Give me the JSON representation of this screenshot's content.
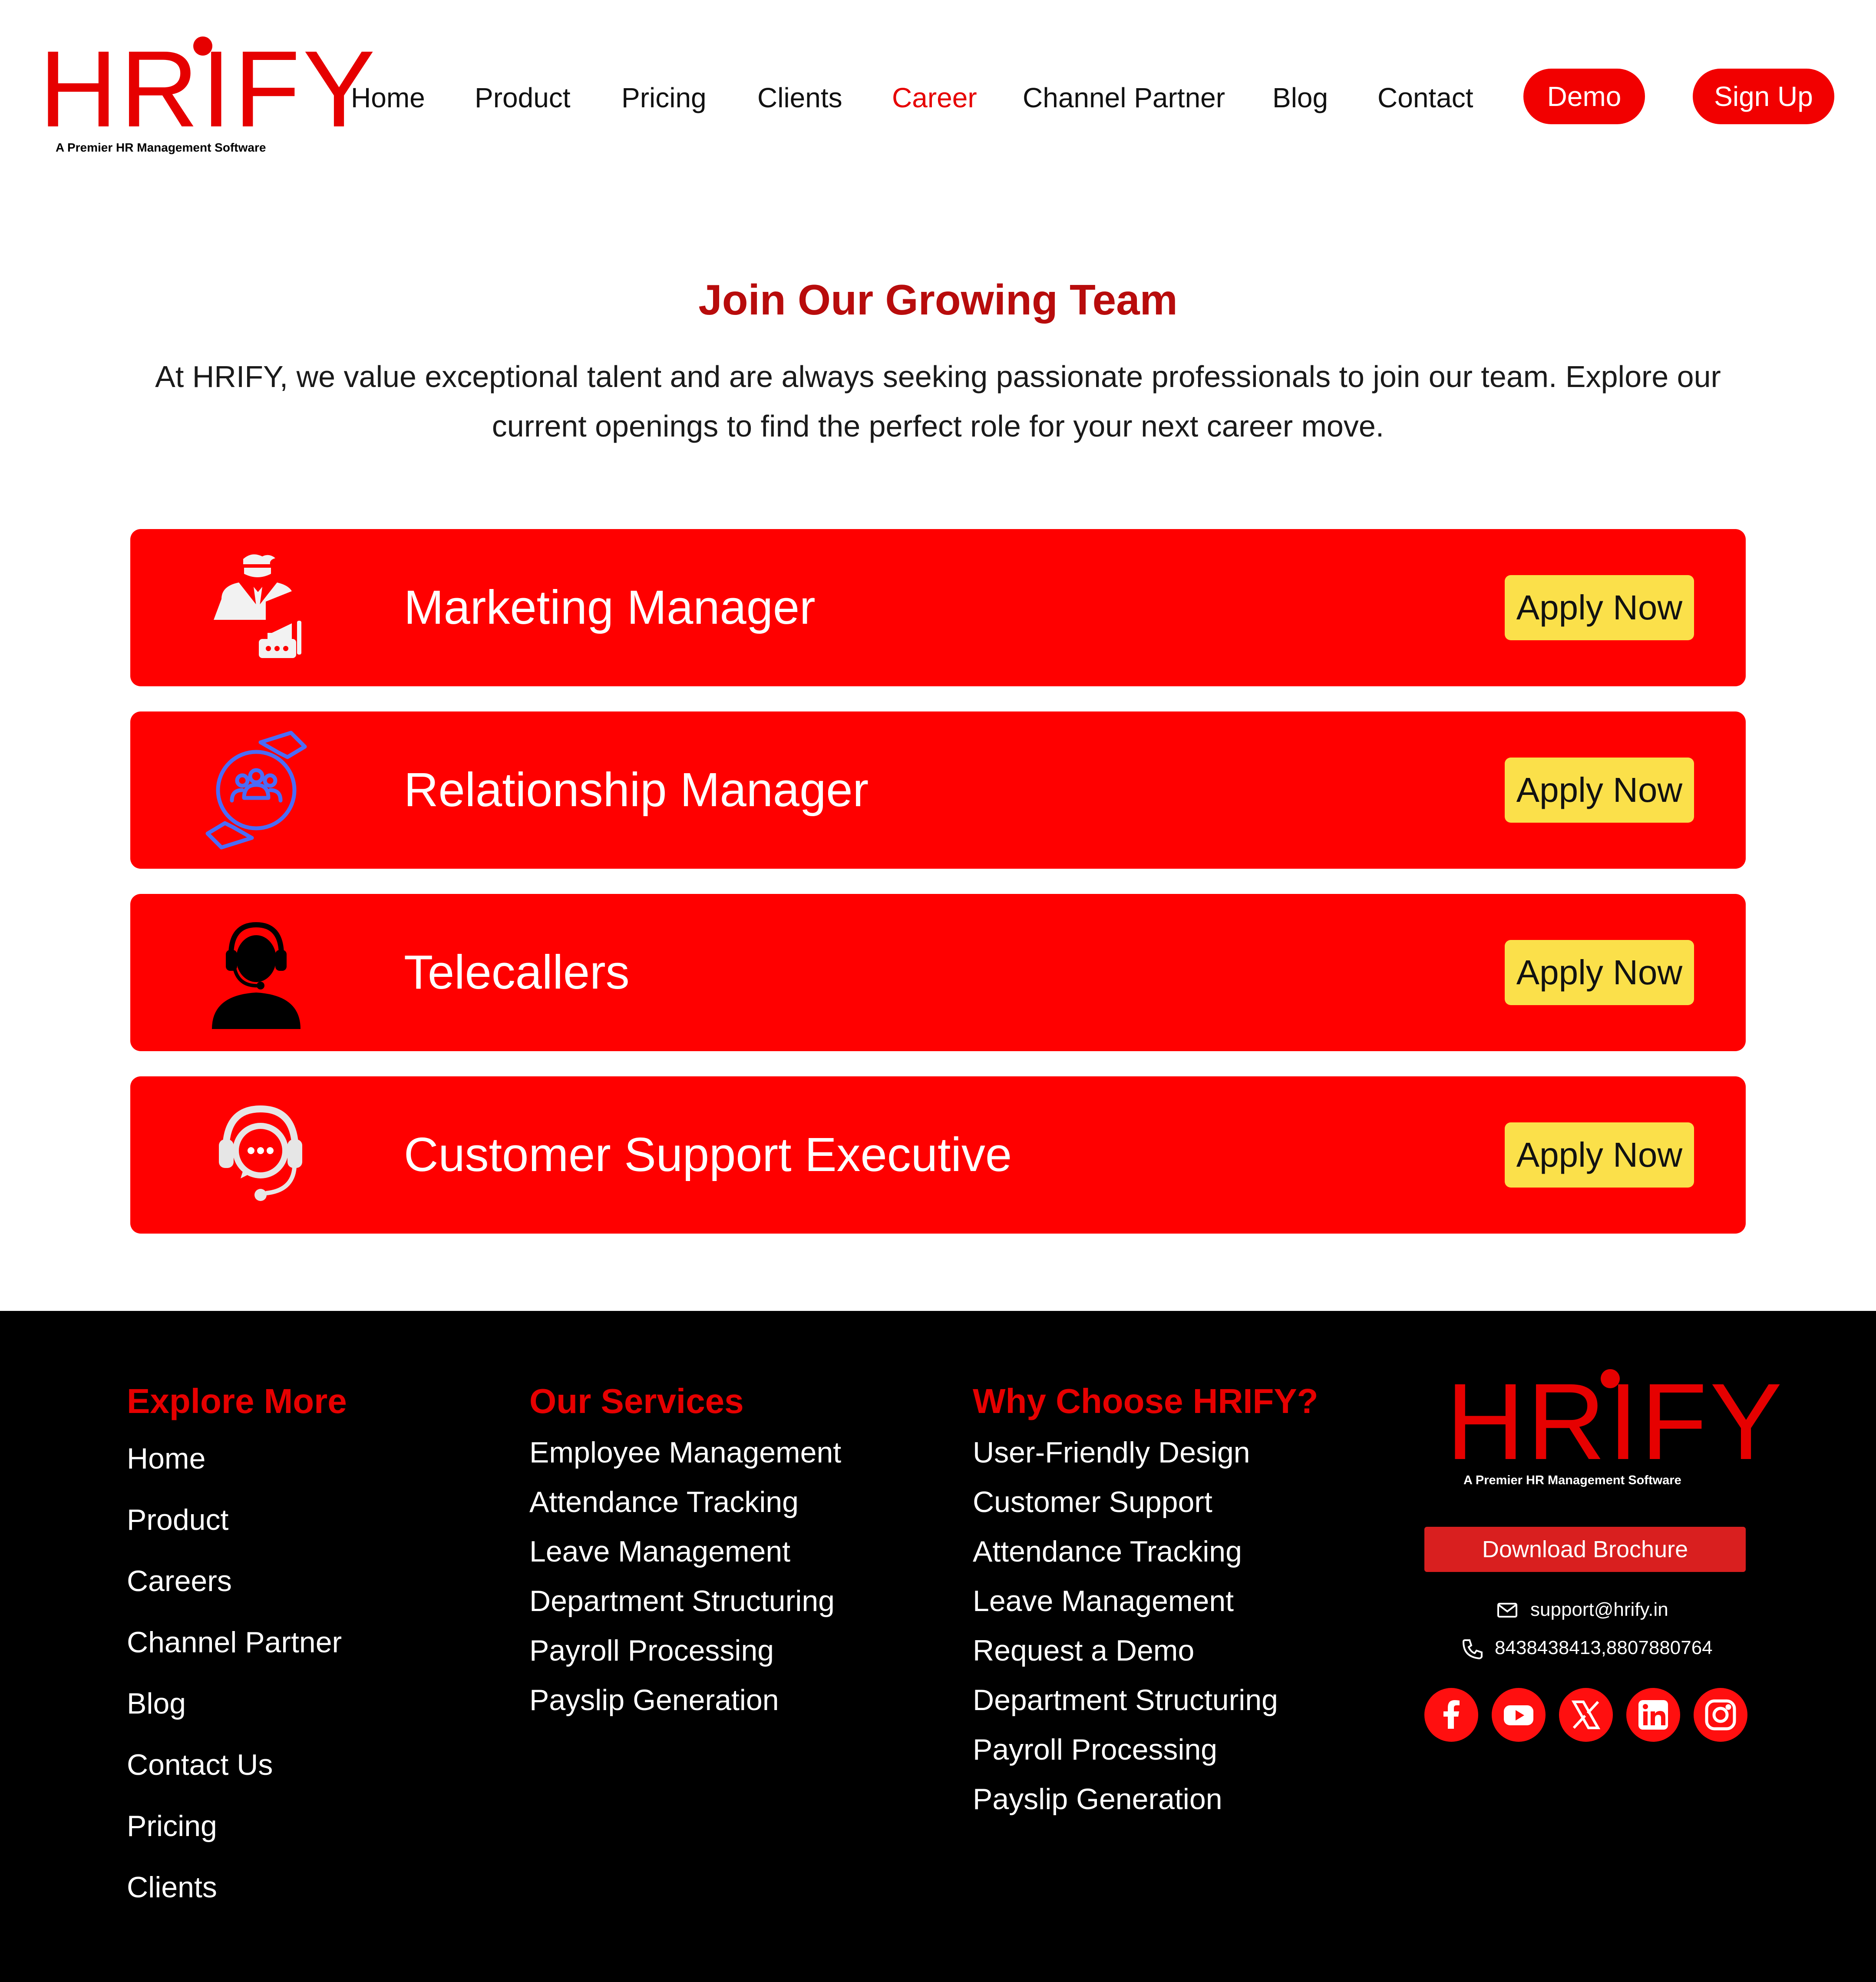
{
  "brand": {
    "name": "HRIFY",
    "tagline": "A Premier HR Management Software",
    "accent": "#e60000"
  },
  "nav": {
    "items": [
      "Home",
      "Product",
      "Pricing",
      "Clients",
      "Career",
      "Channel Partner",
      "Blog",
      "Contact"
    ],
    "active": "Career",
    "demo_label": "Demo",
    "signup_label": "Sign Up"
  },
  "hero": {
    "title": "Join Our Growing Team",
    "text": "At HRIFY, we value exceptional talent and are always seeking passionate professionals to join our team. Explore our current openings to find the perfect role for your next career move."
  },
  "jobs": [
    {
      "title": "Marketing Manager",
      "icon": "marketing-manager-icon",
      "apply_label": "Apply Now"
    },
    {
      "title": "Relationship Manager",
      "icon": "relationship-icon",
      "apply_label": "Apply Now"
    },
    {
      "title": "Telecallers",
      "icon": "telecaller-icon",
      "apply_label": "Apply Now"
    },
    {
      "title": "Customer Support Executive",
      "icon": "customer-support-icon",
      "apply_label": "Apply Now"
    }
  ],
  "footer": {
    "explore": {
      "heading": "Explore More",
      "links": [
        "Home",
        "Product",
        "Careers",
        "Channel Partner",
        "Blog",
        "Contact Us",
        "Pricing",
        "Clients"
      ]
    },
    "services": {
      "heading": "Our Services",
      "links": [
        "Employee Management",
        "Attendance Tracking",
        "Leave Management",
        "Department Structuring",
        "Payroll Processing",
        "Payslip Generation"
      ]
    },
    "why": {
      "heading": "Why Choose HRIFY?",
      "links": [
        "User-Friendly Design",
        "Customer Support",
        "Attendance Tracking",
        "Leave Management",
        "Request a Demo",
        "Department Structuring",
        "Payroll Processing",
        "Payslip Generation"
      ]
    },
    "brochure_label": "Download Brochure",
    "email": "support@hrify.in",
    "phone": "8438438413,8807880764",
    "social": [
      "facebook-icon",
      "youtube-icon",
      "x-icon",
      "linkedin-icon",
      "instagram-icon"
    ]
  }
}
